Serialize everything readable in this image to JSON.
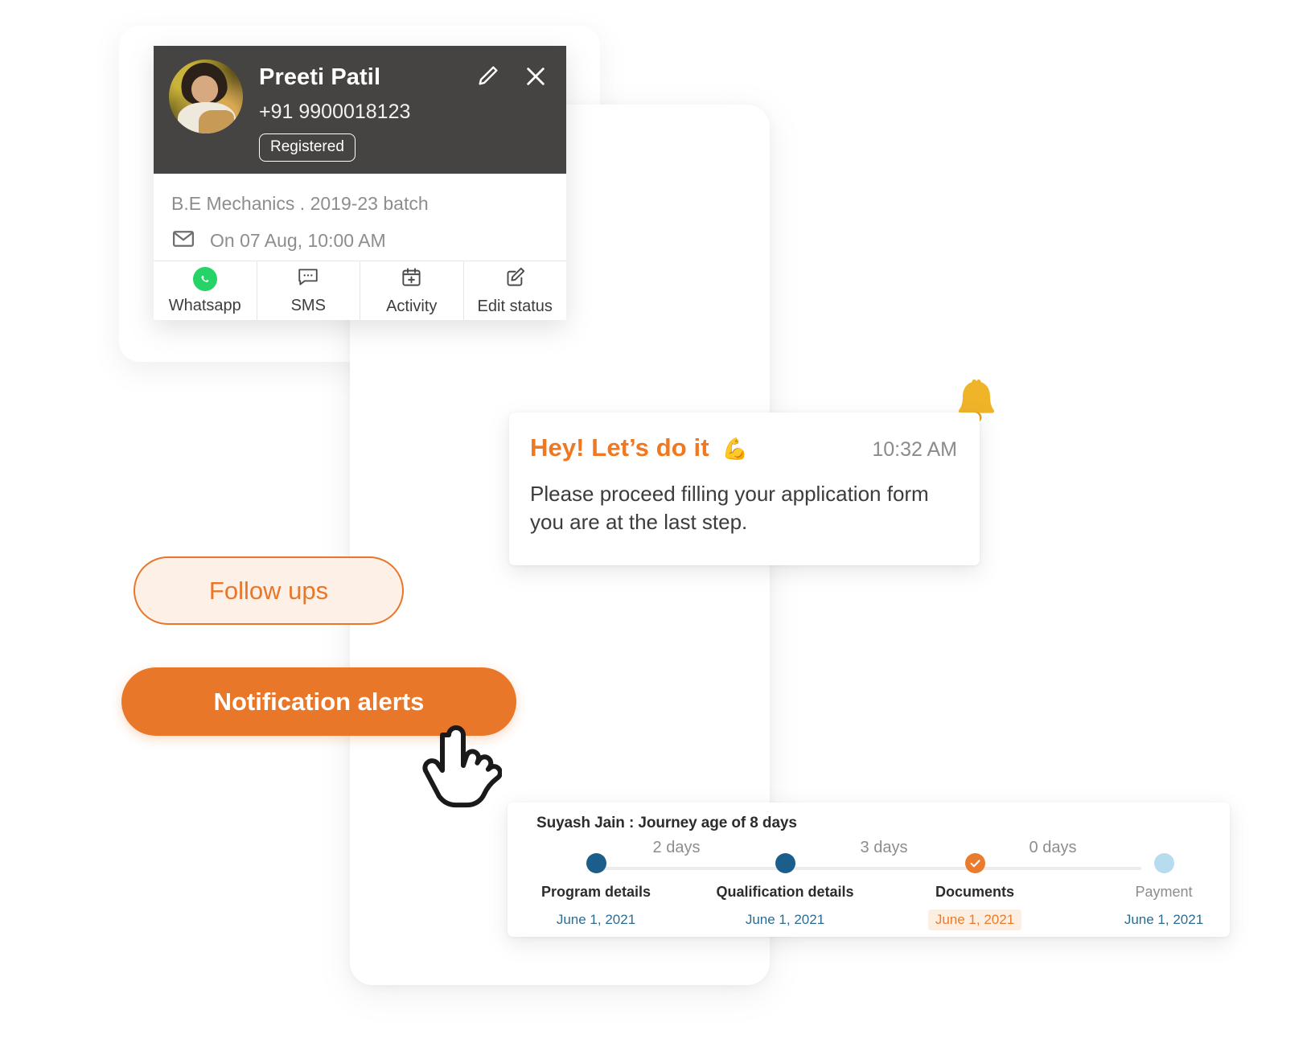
{
  "profile_card": {
    "name": "Preeti Patil",
    "phone": "+91 9900018123",
    "status_badge": "Registered",
    "course": "B.E Mechanics .  2019-23 batch",
    "meeting": "On 07 Aug, 10:00 AM",
    "edit_icon": "pencil-icon",
    "close_icon": "close-icon",
    "mail_icon": "envelope-icon",
    "actions": [
      {
        "label": "Whatsapp",
        "icon": "whatsapp-icon"
      },
      {
        "label": "SMS",
        "icon": "sms-bubble-icon"
      },
      {
        "label": "Activity",
        "icon": "calendar-plus-icon"
      },
      {
        "label": "Edit status",
        "icon": "edit-square-icon"
      }
    ]
  },
  "message": {
    "title": "Hey! Let’s do it",
    "emoji": "💪",
    "time": "10:32 AM",
    "body": "Please proceed filling your application form you are at the last step.",
    "bell_icon": "bell-icon"
  },
  "buttons": {
    "follow_ups": "Follow ups",
    "notification_alerts": "Notification alerts",
    "cursor_icon": "pointing-hand-cursor"
  },
  "journey": {
    "title": "Suyash Jain : Journey age of 8 days",
    "steps": [
      {
        "label": "Program details",
        "date": "June 1, 2021",
        "state": "done",
        "highlight": false
      },
      {
        "label": "Qualification details",
        "date": "June 1, 2021",
        "state": "done",
        "highlight": false
      },
      {
        "label": "Documents",
        "date": "June 1, 2021",
        "state": "current",
        "highlight": true
      },
      {
        "label": "Payment",
        "date": "June 1, 2021",
        "state": "pending",
        "highlight": false
      }
    ],
    "gaps": [
      "2 days",
      "3 days",
      "0 days"
    ]
  },
  "colors": {
    "accent_orange": "#e8772a",
    "header_dark": "#454442",
    "step_done": "#1b5e8c",
    "step_current": "#ea7b2c",
    "step_pending": "#b8dcef",
    "date_blue": "#2b6d93",
    "whatsapp_green": "#25d366"
  }
}
